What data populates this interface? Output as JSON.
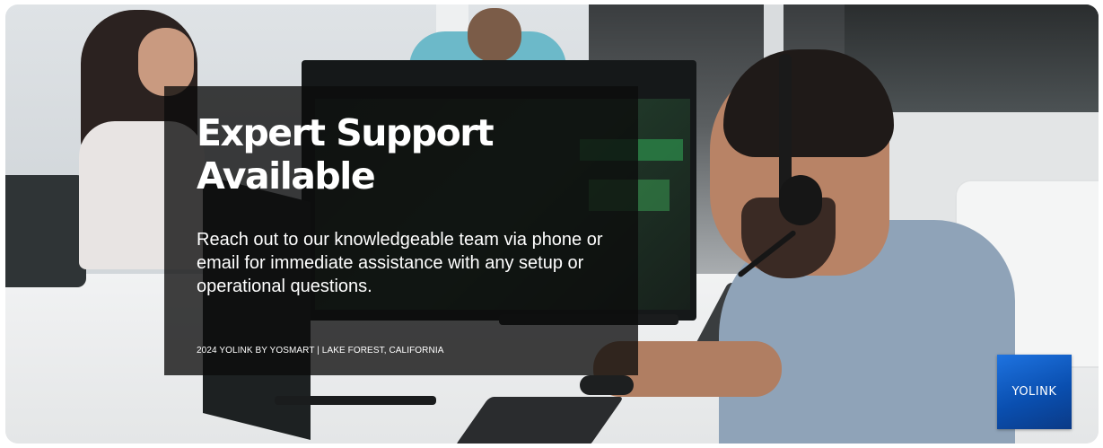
{
  "banner": {
    "headline": "Expert Support Available",
    "body": "Reach out to our knowledgeable team via phone or email for immediate assistance with any setup or operational questions.",
    "footer": "2024 YOLINK BY YOSMART | LAKE FOREST, CALIFORNIA",
    "logo_text": "YOLINK"
  },
  "colors": {
    "overlay": "#0c0c0c",
    "logo_blue": "#0a4fb0",
    "text": "#ffffff"
  },
  "icons": {
    "logo": "yolink-logo-icon"
  }
}
